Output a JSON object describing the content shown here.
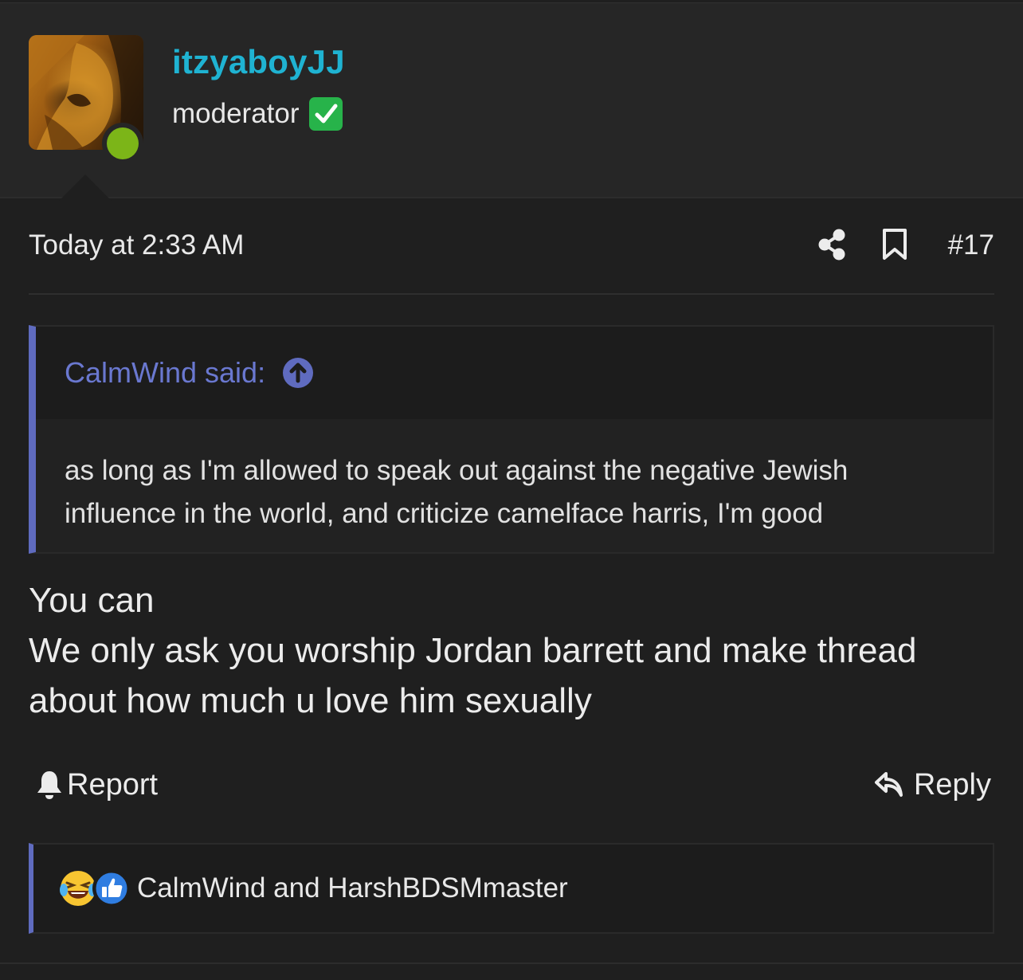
{
  "author": {
    "username": "itzyaboyJJ",
    "title": "moderator",
    "title_badge_icon": "check-mark-button-emoji",
    "online_status_color": "#7cb518"
  },
  "meta": {
    "timestamp": "Today at 2:33 AM",
    "share_icon": "share-icon",
    "bookmark_icon": "bookmark-icon",
    "post_number": "#17"
  },
  "quote": {
    "author_label": "CalmWind said:",
    "jump_icon": "arrow-up-circle-icon",
    "text": "as long as I'm allowed to speak out against the negative Jewish influence in the world, and criticize camelface harris, I'm good"
  },
  "body": {
    "lines": [
      "You can",
      "We only ask you worship Jordan barrett and make thread",
      "about how much u love him sexually"
    ]
  },
  "actions": {
    "report_label": "Report",
    "reply_label": "Reply"
  },
  "reactions": {
    "icons": [
      "laughing-crying-emoji",
      "thumbs-up-icon"
    ],
    "reactors_text": "CalmWind and HarshBDSMmaster"
  },
  "colors": {
    "username": "#1fb3d2",
    "quote_accent": "#5f6bbf",
    "background": "#1f1f1f",
    "header_background": "#262626"
  }
}
